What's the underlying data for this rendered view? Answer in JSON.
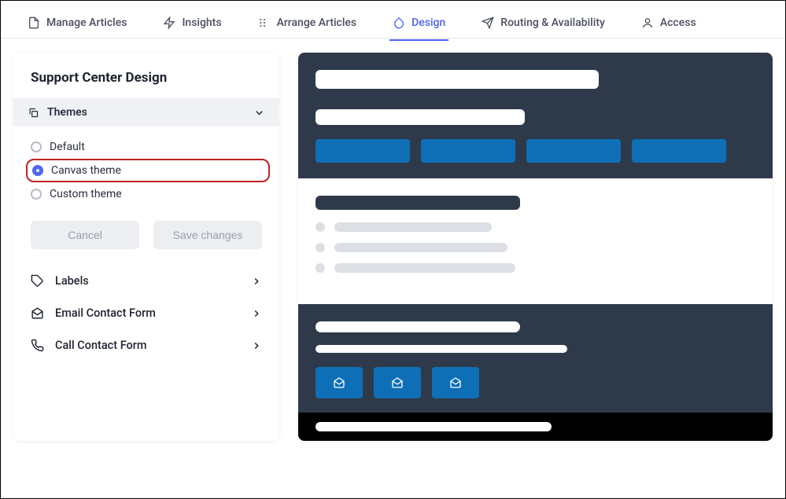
{
  "tabs": {
    "manage": "Manage Articles",
    "insights": "Insights",
    "arrange": "Arrange Articles",
    "design": "Design",
    "routing": "Routing & Availability",
    "access": "Access"
  },
  "sidebar": {
    "title": "Support Center Design",
    "section_themes": "Themes",
    "themes": {
      "default": "Default",
      "canvas": "Canvas theme",
      "custom": "Custom theme"
    },
    "buttons": {
      "cancel": "Cancel",
      "save": "Save changes"
    },
    "nav": {
      "labels": "Labels",
      "email_form": "Email Contact Form",
      "call_form": "Call Contact Form"
    }
  }
}
